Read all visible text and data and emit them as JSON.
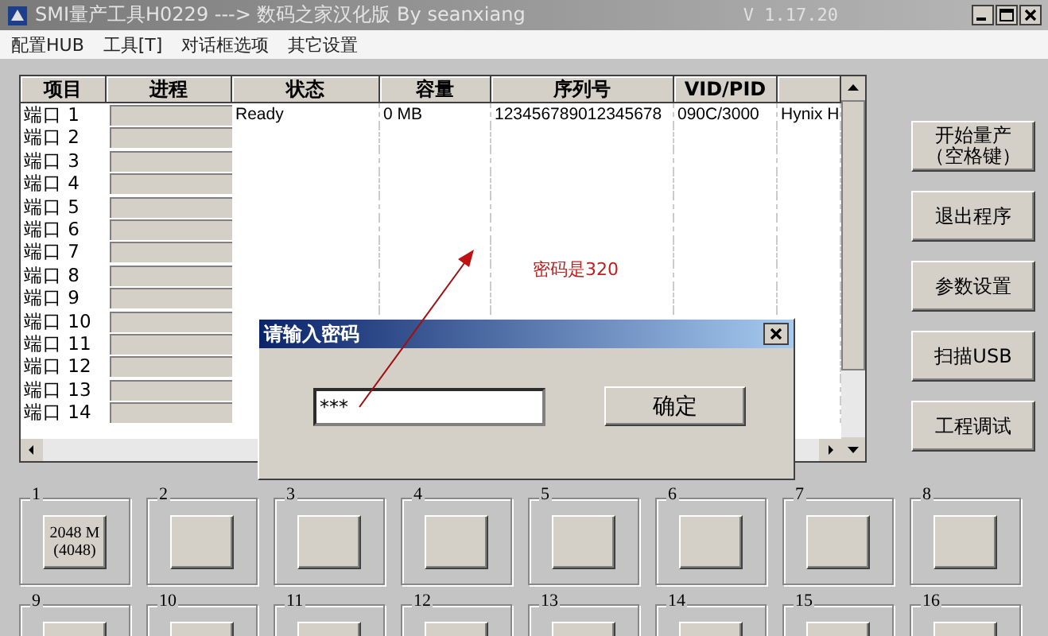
{
  "window": {
    "title": "SMI量产工具H0229 ---> 数码之家汉化版 By seanxiang",
    "version": "V 1.17.20"
  },
  "menu": [
    "配置HUB",
    "工具[T]",
    "对话框选项",
    "其它设置"
  ],
  "table": {
    "columns": [
      "项目",
      "进程",
      "状态",
      "容量",
      "序列号",
      "VID/PID"
    ],
    "rows": [
      {
        "port": "端口 1",
        "level": 0,
        "status": "Ready",
        "capacity": "0 MB",
        "serial": "123456789012345678",
        "vid_pid": "090C/3000",
        "column_7": "Hynix H"
      },
      {
        "port": "端口 2",
        "level": 0
      },
      {
        "port": "端口 3",
        "level": 0
      },
      {
        "port": "端口 4",
        "level": 0
      },
      {
        "port": "端口 5",
        "level": 0
      },
      {
        "port": "端口 6",
        "level": 0
      },
      {
        "port": "端口 7",
        "level": 0
      },
      {
        "port": "端口 8",
        "level": 0
      },
      {
        "port": "端口 9",
        "level": 0
      },
      {
        "port": "端口 10",
        "level": 0
      },
      {
        "port": "端口 11",
        "level": 0
      },
      {
        "port": "端口 12",
        "level": 0
      },
      {
        "port": "端口 13",
        "level": 0
      },
      {
        "port": "端口 14",
        "level": 0
      }
    ]
  },
  "side_buttons": [
    {
      "lines": [
        "开始量产",
        "（空格键）"
      ]
    },
    {
      "lines": [
        "退出程序"
      ]
    },
    {
      "lines": [
        "参数设置"
      ]
    },
    {
      "lines": [
        "扫描USB"
      ]
    },
    {
      "lines": [
        "工程调试"
      ]
    }
  ],
  "ports": [
    {
      "number": "1",
      "lines": [
        "2048 M",
        "(4048)"
      ]
    },
    {
      "number": "2"
    },
    {
      "number": "3"
    },
    {
      "number": "4"
    },
    {
      "number": "5"
    },
    {
      "number": "6"
    },
    {
      "number": "7"
    },
    {
      "number": "8"
    },
    {
      "number": "9"
    },
    {
      "number": "10"
    },
    {
      "number": "11"
    },
    {
      "number": "12"
    },
    {
      "number": "13"
    },
    {
      "number": "14"
    },
    {
      "number": "15"
    },
    {
      "number": "16"
    }
  ],
  "dialog": {
    "title": "请输入密码",
    "password": "***",
    "ok_button": "确定"
  },
  "annotation": {
    "text": "密码是320"
  }
}
